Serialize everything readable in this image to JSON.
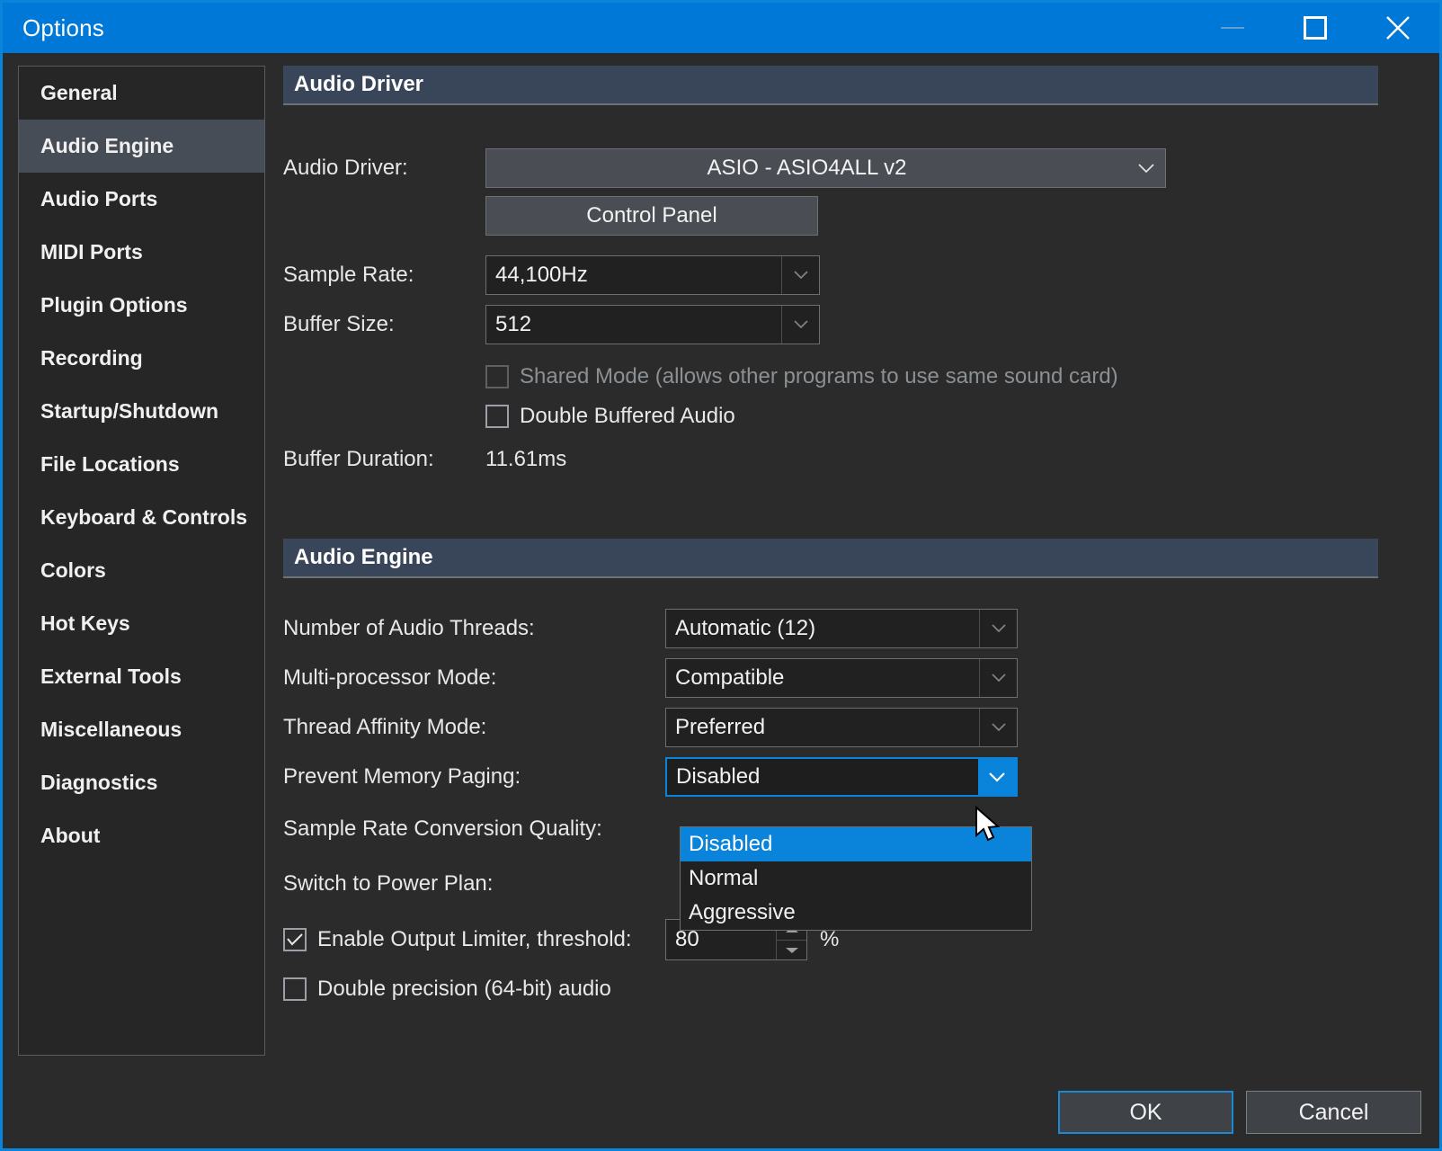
{
  "window": {
    "title": "Options",
    "accent_color": "#0078d7",
    "border_color": "#0a84da",
    "background": "#2b2b2b",
    "controls": {
      "minimize": "minimize-icon",
      "maximize": "maximize-icon",
      "close": "close-icon"
    }
  },
  "sidebar": {
    "items": [
      {
        "label": "General",
        "selected": false
      },
      {
        "label": "Audio Engine",
        "selected": true
      },
      {
        "label": "Audio Ports",
        "selected": false
      },
      {
        "label": "MIDI Ports",
        "selected": false
      },
      {
        "label": "Plugin Options",
        "selected": false
      },
      {
        "label": "Recording",
        "selected": false
      },
      {
        "label": "Startup/Shutdown",
        "selected": false
      },
      {
        "label": "File Locations",
        "selected": false
      },
      {
        "label": "Keyboard & Controls",
        "selected": false
      },
      {
        "label": "Colors",
        "selected": false
      },
      {
        "label": "Hot Keys",
        "selected": false
      },
      {
        "label": "External Tools",
        "selected": false
      },
      {
        "label": "Miscellaneous",
        "selected": false
      },
      {
        "label": "Diagnostics",
        "selected": false
      },
      {
        "label": "About",
        "selected": false
      }
    ]
  },
  "audio_driver": {
    "header": "Audio Driver",
    "driver_label": "Audio Driver:",
    "driver_value": "ASIO - ASIO4ALL v2",
    "control_panel_button": "Control Panel",
    "sample_rate_label": "Sample Rate:",
    "sample_rate_value": "44,100Hz",
    "buffer_size_label": "Buffer Size:",
    "buffer_size_value": "512",
    "shared_mode_label": "Shared Mode (allows other programs to use same sound card)",
    "shared_mode_checked": false,
    "shared_mode_disabled": true,
    "double_buffered_label": "Double Buffered Audio",
    "double_buffered_checked": false,
    "buffer_duration_label": "Buffer Duration:",
    "buffer_duration_value": "11.61ms"
  },
  "audio_engine": {
    "header": "Audio Engine",
    "threads_label": "Number of Audio Threads:",
    "threads_value": "Automatic (12)",
    "multiproc_label": "Multi-processor Mode:",
    "multiproc_value": "Compatible",
    "affinity_label": "Thread Affinity Mode:",
    "affinity_value": "Preferred",
    "paging_label": "Prevent Memory Paging:",
    "paging_value": "Disabled",
    "paging_options": [
      "Disabled",
      "Normal",
      "Aggressive"
    ],
    "paging_highlighted": "Disabled",
    "srcq_label": "Sample Rate Conversion Quality:",
    "power_plan_label": "Switch to Power Plan:",
    "limiter_label": "Enable Output Limiter, threshold:",
    "limiter_checked": true,
    "limiter_value": "80",
    "limiter_unit": "%",
    "double_precision_label": "Double precision (64-bit) audio",
    "double_precision_checked": false
  },
  "footer": {
    "ok_label": "OK",
    "cancel_label": "Cancel"
  }
}
